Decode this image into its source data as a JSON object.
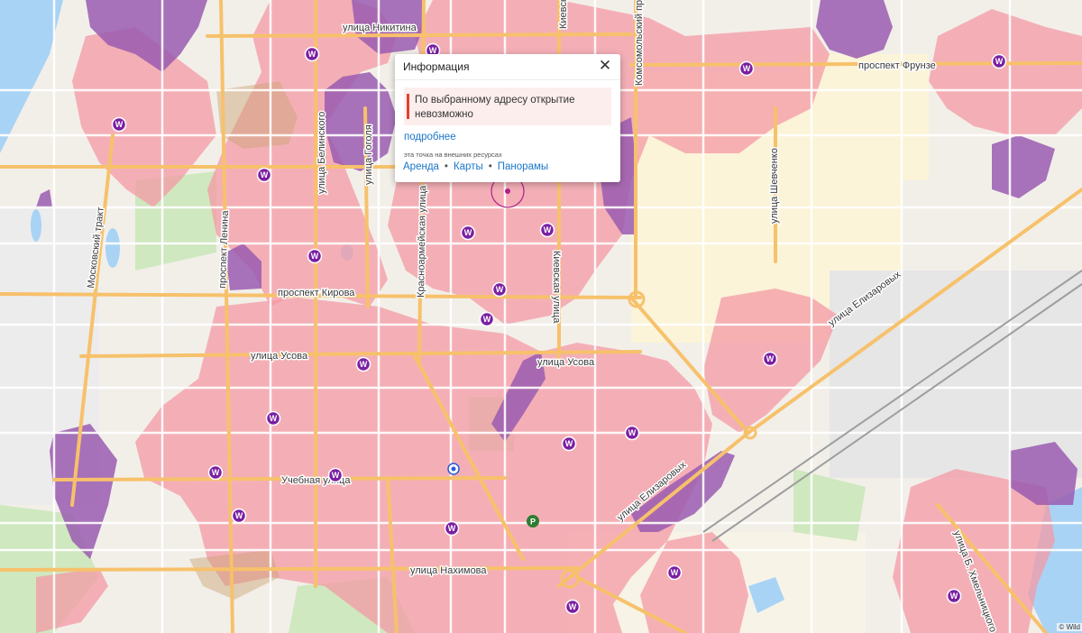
{
  "popup": {
    "title": "Информация",
    "close_glyph": "✕",
    "alert_text": "По выбранному адресу открытие невозможно",
    "more_link": "подробнее",
    "external_note": "эта точка на внешних ресурсах",
    "links": [
      "Аренда",
      "Карты",
      "Панорамы"
    ],
    "separator": "•"
  },
  "copyright": "© Wild",
  "poi_glyph": "W",
  "streets": {
    "nikitina": "улица Никитина",
    "kievskaya_top": "Киевская",
    "komsomolsky": "Комсомольский проспект",
    "frunze": "проспект Фрунзе",
    "belinskogo": "улица Белинского",
    "gogolya": "улица Гоголя",
    "shevchenko": "улица Шевченко",
    "moskovsky": "Московский тракт",
    "lenina": "проспект Ленина",
    "krasnoarmeyskaya": "Красноармейская улица",
    "kievskaya": "Киевская улица",
    "elizarovykh_ne": "улица Елизаровых",
    "kirova": "проспект Кирова",
    "usova_w": "улица Усова",
    "usova_e": "улица Усова",
    "uchebnaya": "Учебная улица",
    "elizarovykh_s": "улица Елизаровых",
    "nakhimova": "улица Нахимова",
    "khmelnitskogo": "улица Б. Хмельницкого"
  },
  "colors": {
    "background": "#f2efe9",
    "coverage_zone": "#f49aa4",
    "busy_zone": "#9a5cb0",
    "poi": "#7b1fa2",
    "road": "#f7c16b",
    "water": "#a9d3f5",
    "park": "#cfe8bf",
    "alert_accent": "#e6402c",
    "link": "#1a76c9"
  },
  "icons": {
    "poi": "wildberries-pickup-point-icon",
    "selected": "selected-location-marker-icon",
    "close": "close-icon",
    "transport": "transport-stop-icon",
    "parking": "parking-icon"
  }
}
